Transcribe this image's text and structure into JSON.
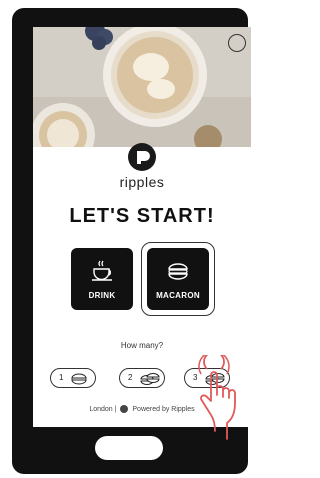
{
  "brand": {
    "name": "ripples",
    "logo_icon": "ripples-logo-icon"
  },
  "hero": {
    "image": "coffee-latte-art-photo",
    "profile_icon": "user-profile-icon"
  },
  "headline": "LET'S START!",
  "options": [
    {
      "label": "DRINK",
      "icon": "coffee-cup-icon",
      "selected": false
    },
    {
      "label": "MACARON",
      "icon": "macaron-icon",
      "selected": true
    }
  ],
  "quantity": {
    "prompt": "How many?",
    "choices": [
      {
        "count": "1",
        "icon": "macaron-icon"
      },
      {
        "count": "2",
        "icon": "macaron-icon"
      },
      {
        "count": "3",
        "icon": "macaron-icon"
      }
    ]
  },
  "footer": {
    "location": "London",
    "separator": "|",
    "powered_by": "Powered by Ripples"
  },
  "colors": {
    "tile": "#111111",
    "device": "#111111",
    "text": "#222222"
  },
  "overlay": {
    "icon": "tap-hand-icon",
    "color": "#e05a5a"
  }
}
